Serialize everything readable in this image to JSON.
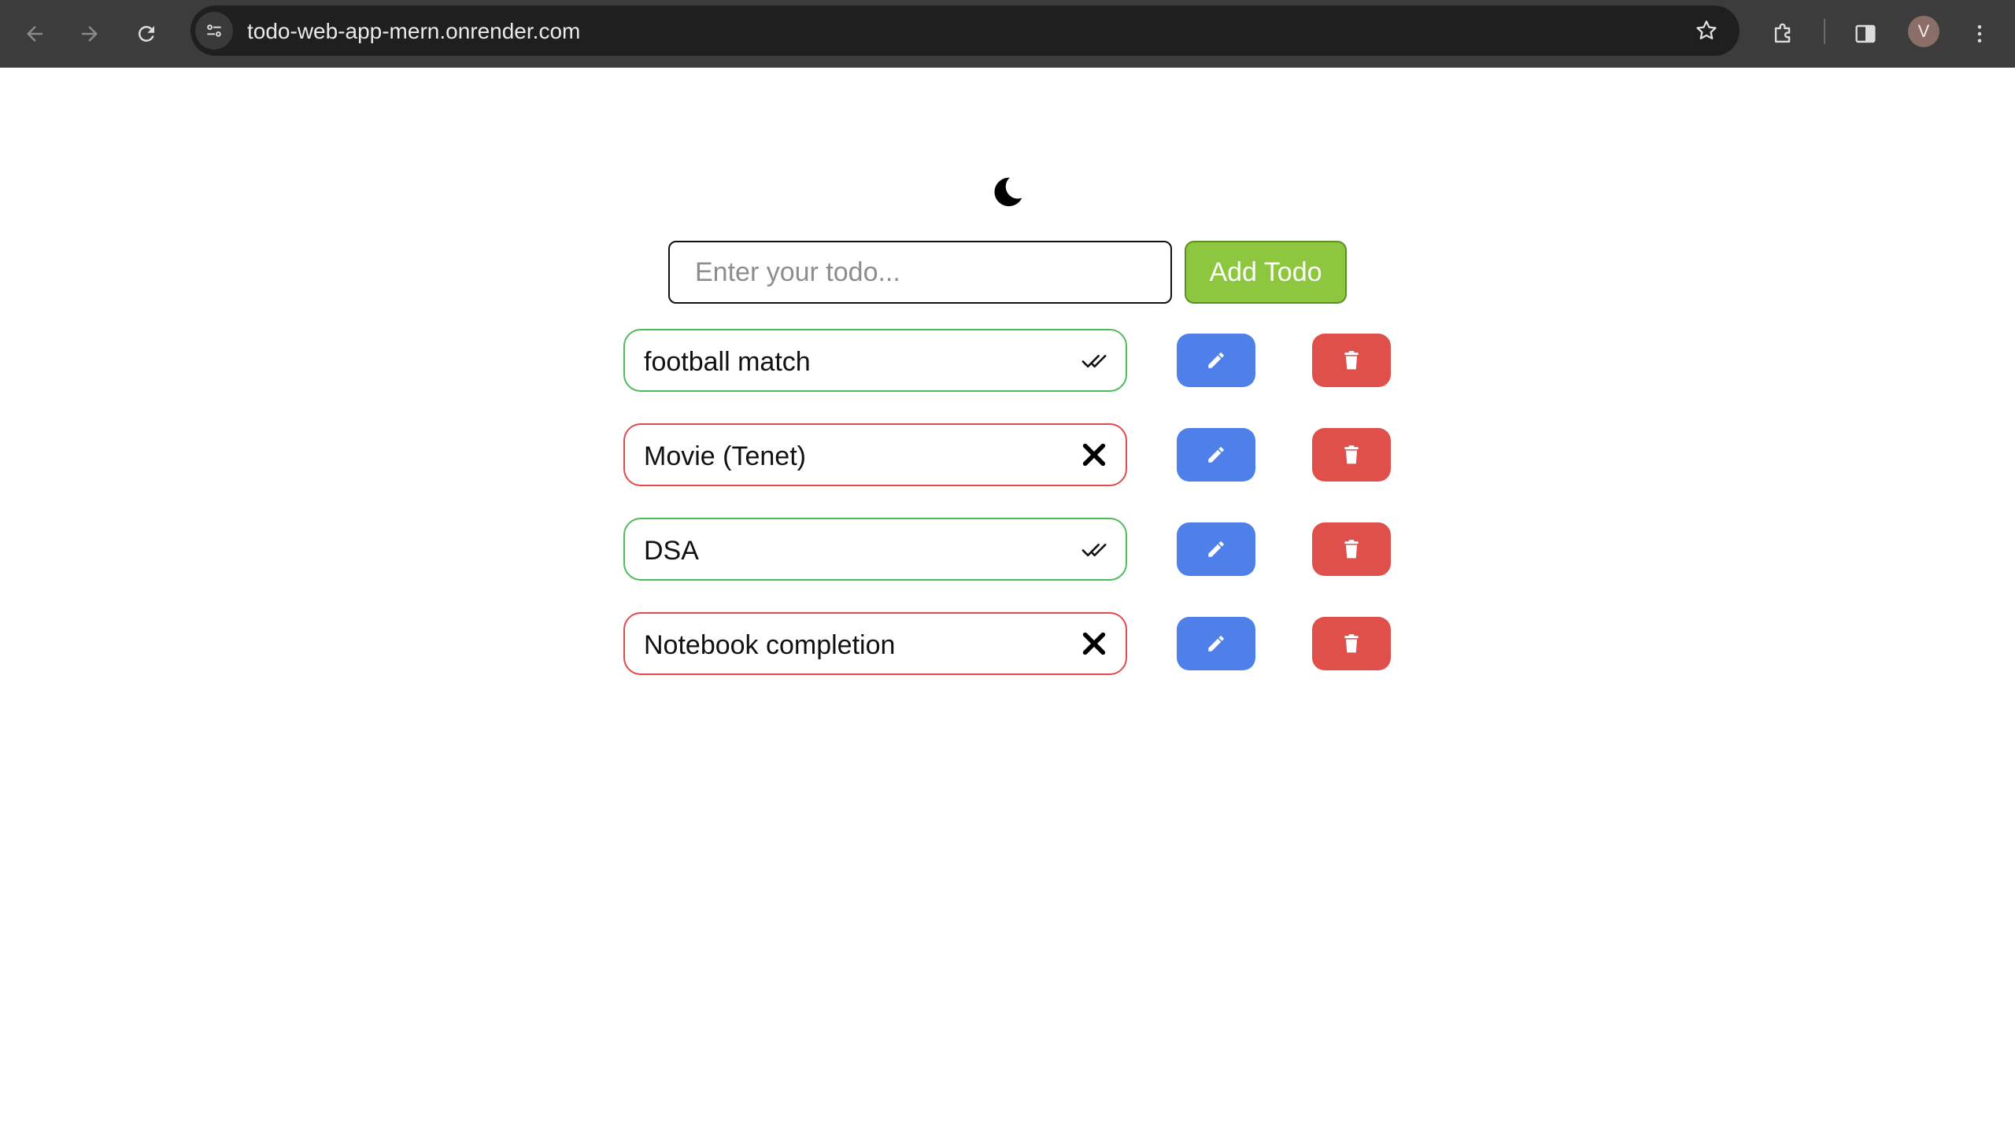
{
  "browser": {
    "url": "todo-web-app-mern.onrender.com",
    "profile_initial": "V",
    "icons": [
      "back-arrow-icon",
      "forward-arrow-icon",
      "reload-icon",
      "site-info-icon",
      "bookmark-star-icon",
      "extensions-icon",
      "side-panel-icon",
      "kebab-menu-icon"
    ]
  },
  "app": {
    "theme_toggle_icon": "moon-icon",
    "input": {
      "placeholder": "Enter your todo...",
      "value": ""
    },
    "add_button_label": "Add Todo",
    "todos": [
      {
        "text": "football match",
        "completed": true,
        "status_icon": "double-check-icon"
      },
      {
        "text": "Movie (Tenet)",
        "completed": false,
        "status_icon": "x-mark-icon"
      },
      {
        "text": "DSA",
        "completed": true,
        "status_icon": "double-check-icon"
      },
      {
        "text": "Notebook completion",
        "completed": false,
        "status_icon": "x-mark-icon"
      }
    ],
    "edit_icon": "pencil-icon",
    "delete_icon": "trash-icon"
  },
  "colors": {
    "chrome_bg": "#3c3c3c",
    "add_button": "#8dc63f",
    "completed_border": "#4cbb5a",
    "pending_border": "#e24a4a",
    "edit_button": "#4f7fe8",
    "delete_button": "#e0504a"
  }
}
